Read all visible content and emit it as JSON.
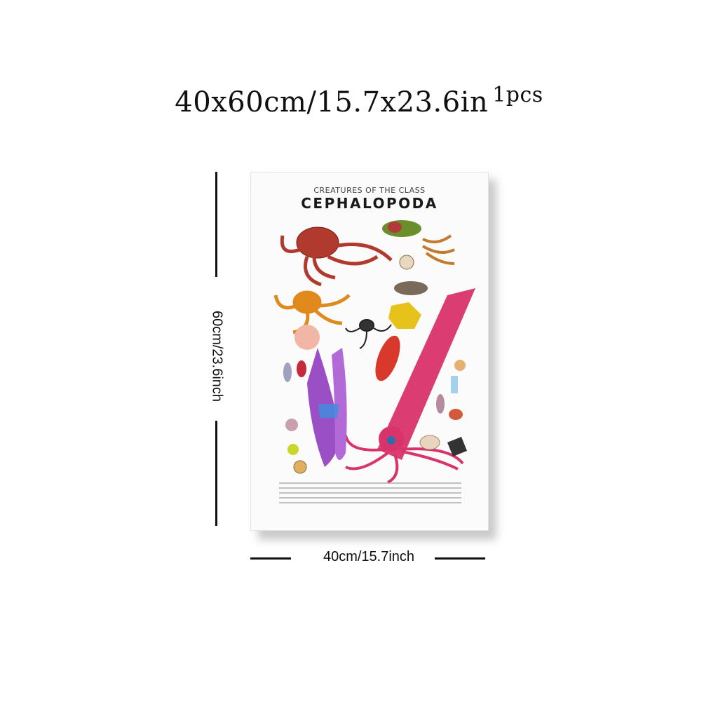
{
  "headline": {
    "size": "40x60cm/15.7x23.6in",
    "qty": "1pcs"
  },
  "poster": {
    "subtitle": "CREATURES OF THE CLASS",
    "title": "CEPHALOPODA"
  },
  "dimensions": {
    "height_label": "60cm/23.6inch",
    "width_label": "40cm/15.7inch"
  },
  "colors": {
    "squid": "#d9336b",
    "octopus": "#b03a2e",
    "orange_octopus": "#e08a1e",
    "purple": "#9a4fc4"
  }
}
